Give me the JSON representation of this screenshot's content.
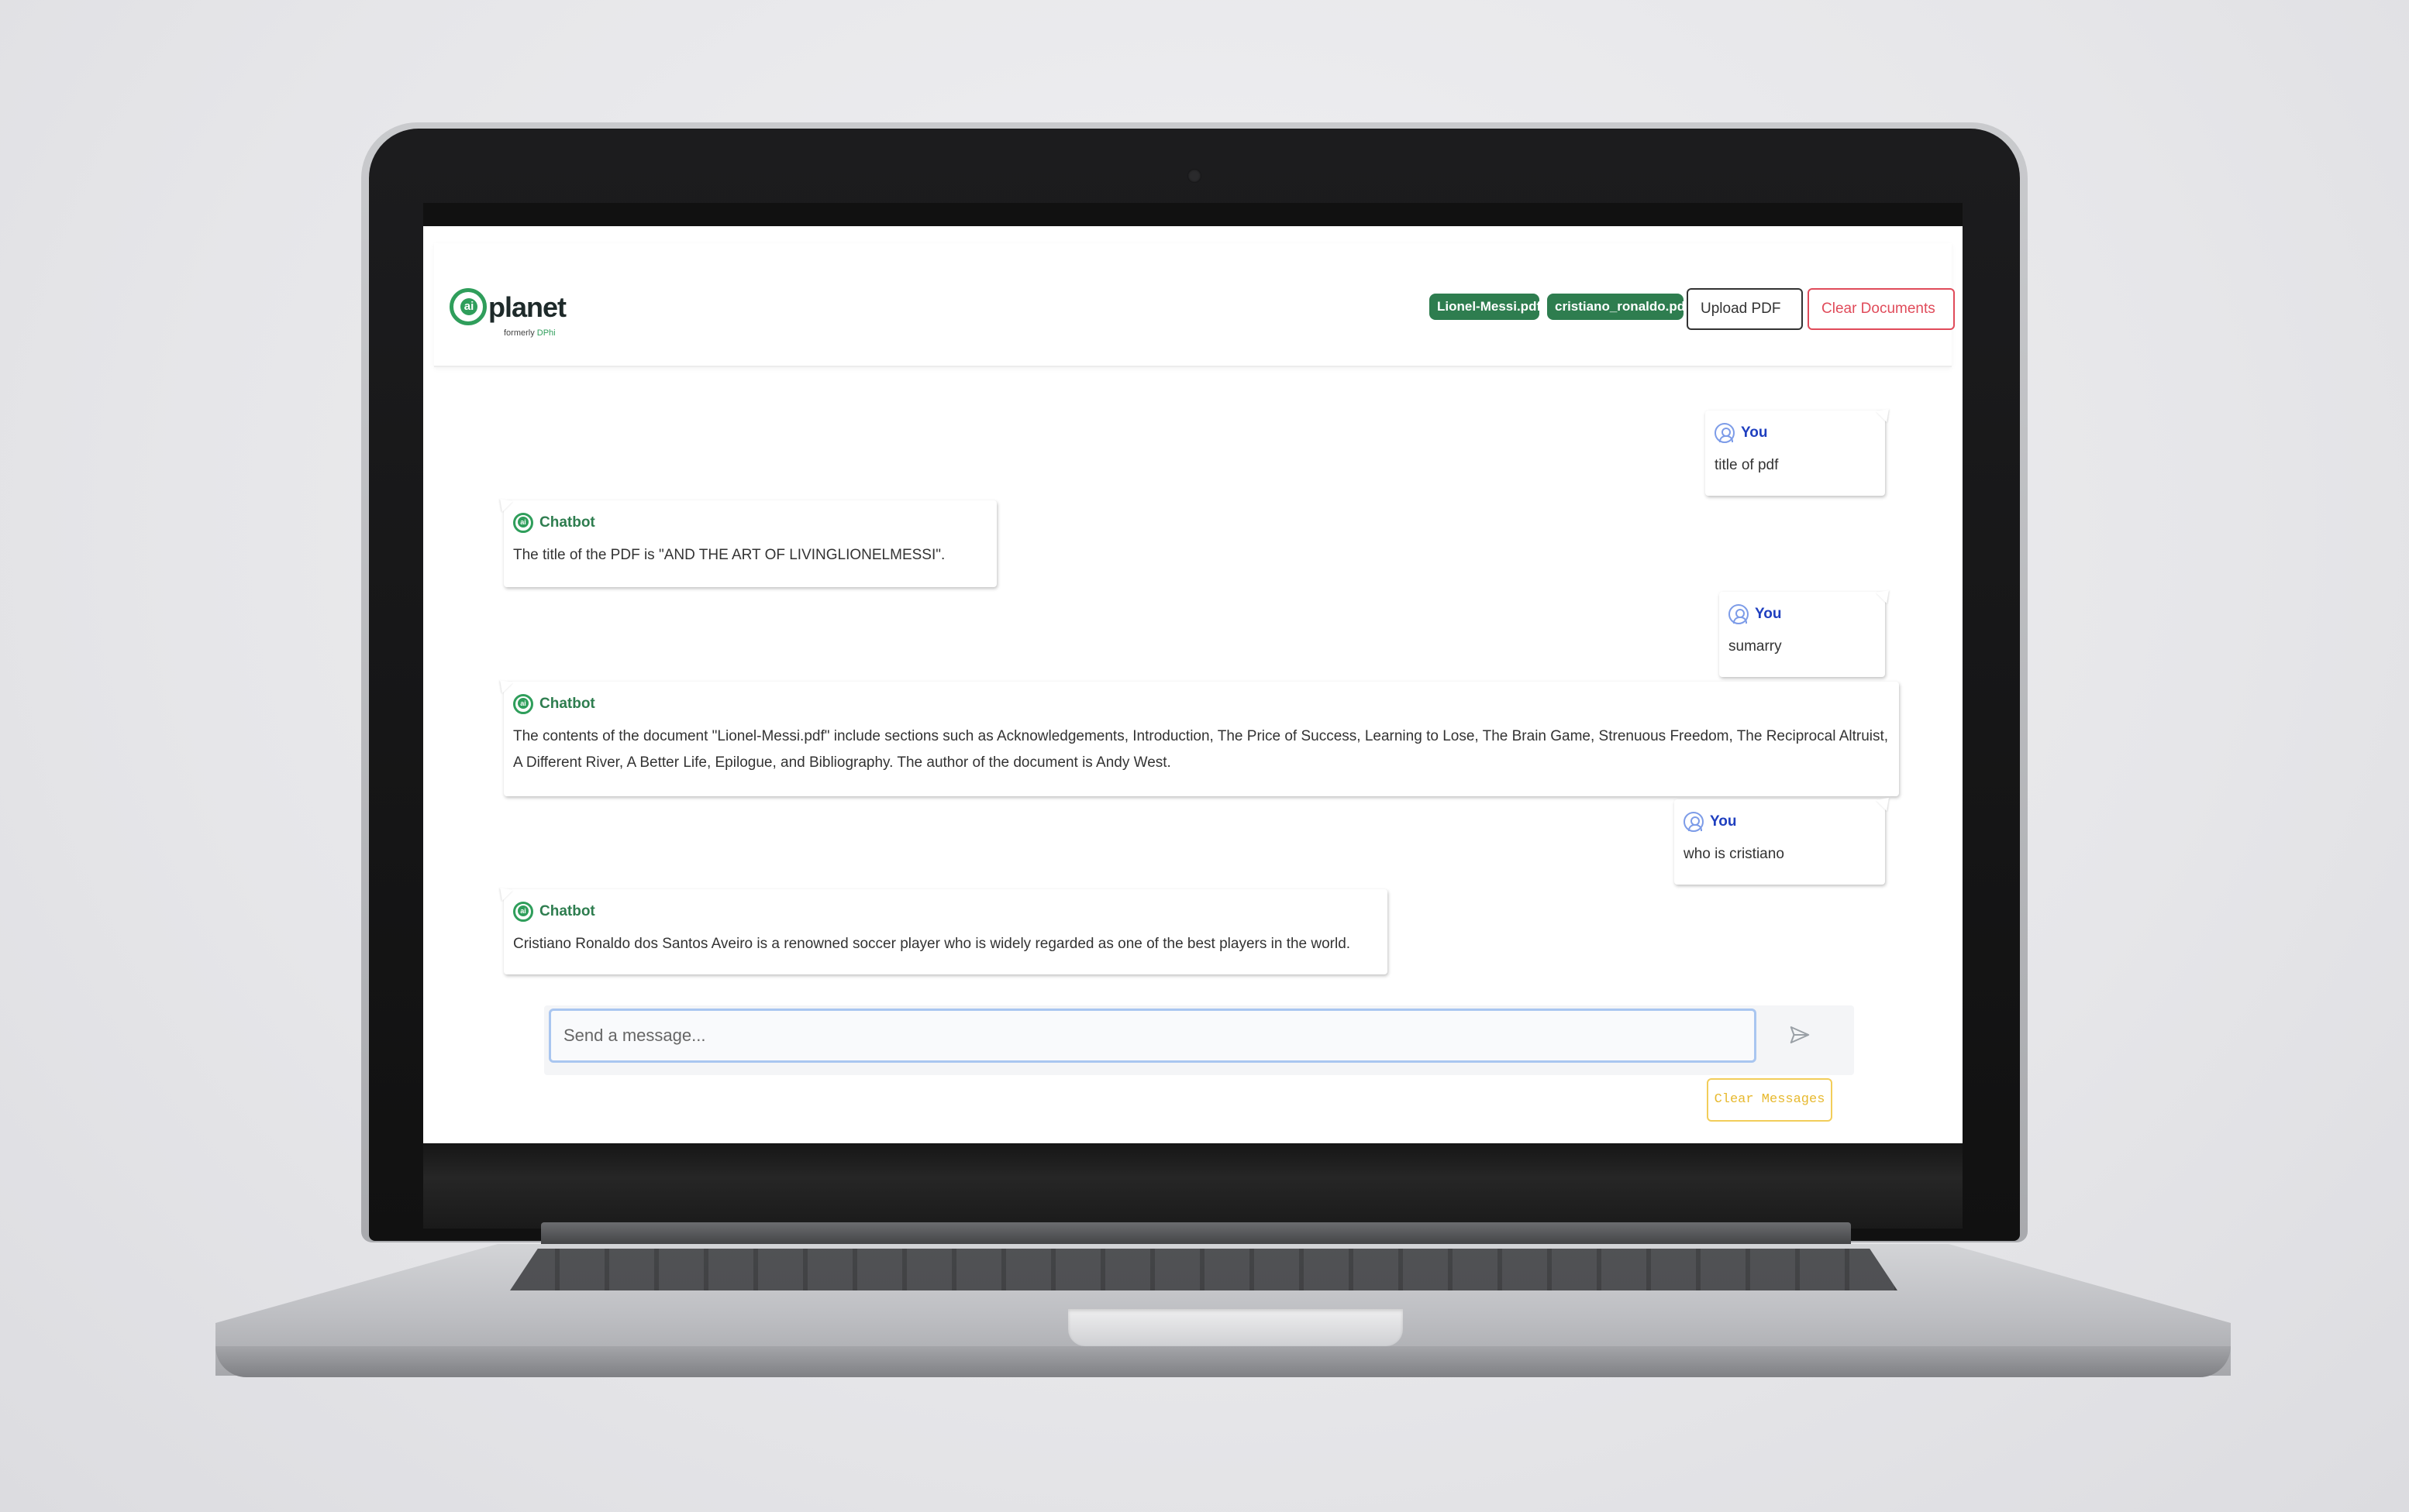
{
  "header": {
    "logo_word": "planet",
    "logo_mark": "ai",
    "logo_sub_prefix": "formerly ",
    "logo_sub_accent": "DPhi",
    "documents": [
      "Lionel-Messi.pdf",
      "cristiano_ronaldo.pdf"
    ],
    "upload_label": "Upload PDF",
    "clear_documents_label": "Clear Documents"
  },
  "messages": [
    {
      "author": "You",
      "role": "user",
      "text": "title of pdf"
    },
    {
      "author": "Chatbot",
      "role": "bot",
      "text": "The title of the PDF is \"AND THE ART OF LIVINGLIONELMESSI\"."
    },
    {
      "author": "You",
      "role": "user",
      "text": "sumarry"
    },
    {
      "author": "Chatbot",
      "role": "bot",
      "text": "The contents of the document \"Lionel-Messi.pdf\" include sections such as Acknowledgements, Introduction, The Price of Success, Learning to Lose, The Brain Game, Strenuous Freedom, The Reciprocal Altruist, A Different River, A Better Life, Epilogue, and Bibliography. The author of the document is Andy West."
    },
    {
      "author": "You",
      "role": "user",
      "text": "who is cristiano"
    },
    {
      "author": "Chatbot",
      "role": "bot",
      "text": "Cristiano Ronaldo dos Santos Aveiro is a renowned soccer player who is widely regarded as one of the best players in the world."
    }
  ],
  "composer": {
    "placeholder": "Send a message...",
    "send_icon": "send-icon",
    "clear_messages_label": "Clear Messages"
  },
  "colors": {
    "brand_green": "#2f9e5b",
    "chip_green": "#2e7d4f",
    "user_blue": "#1f3fbf",
    "danger_red": "#e04b5a",
    "warning_yellow": "#f2cd5a"
  }
}
